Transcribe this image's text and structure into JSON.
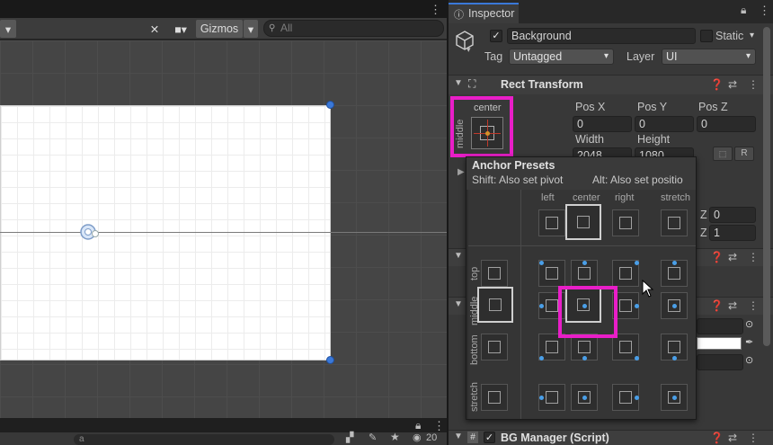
{
  "scene_toolbar": {
    "gizmos_label": "Gizmos",
    "search_placeholder": "All"
  },
  "bottom_bar": {
    "search_value": "a",
    "visibility_count": "20"
  },
  "inspector": {
    "tab_label": "Inspector",
    "object_name": "Background",
    "static_label": "Static",
    "tag_label": "Tag",
    "tag_value": "Untagged",
    "layer_label": "Layer",
    "layer_value": "UI"
  },
  "rect_transform": {
    "title": "Rect Transform",
    "anchor_h": "center",
    "anchor_v": "middle",
    "pos_x_label": "Pos X",
    "pos_y_label": "Pos Y",
    "pos_z_label": "Pos Z",
    "pos_x": "0",
    "pos_y": "0",
    "pos_z": "0",
    "width_label": "Width",
    "height_label": "Height",
    "width": "2048",
    "height": "1080",
    "r_label": "R",
    "z_label_1": "Z",
    "z_value_1": "0",
    "z_label_2": "Z",
    "z_value_2": "1"
  },
  "anchor_presets": {
    "title": "Anchor Presets",
    "hint_shift": "Shift: Also set pivot",
    "hint_alt": "Alt: Also set positio",
    "columns": [
      "left",
      "center",
      "right",
      "stretch"
    ],
    "rows": [
      "top",
      "middle",
      "bottom",
      "stretch"
    ]
  },
  "bg_manager": {
    "title": "BG Manager (Script)",
    "icon_label": "#"
  },
  "colors": {
    "accent_blue": "#3a78d8",
    "highlight_pink": "#e91ec8",
    "anchor_red": "#c0392b",
    "anchor_orange": "#d4902a",
    "pivot_blue": "#4a9fe8"
  }
}
